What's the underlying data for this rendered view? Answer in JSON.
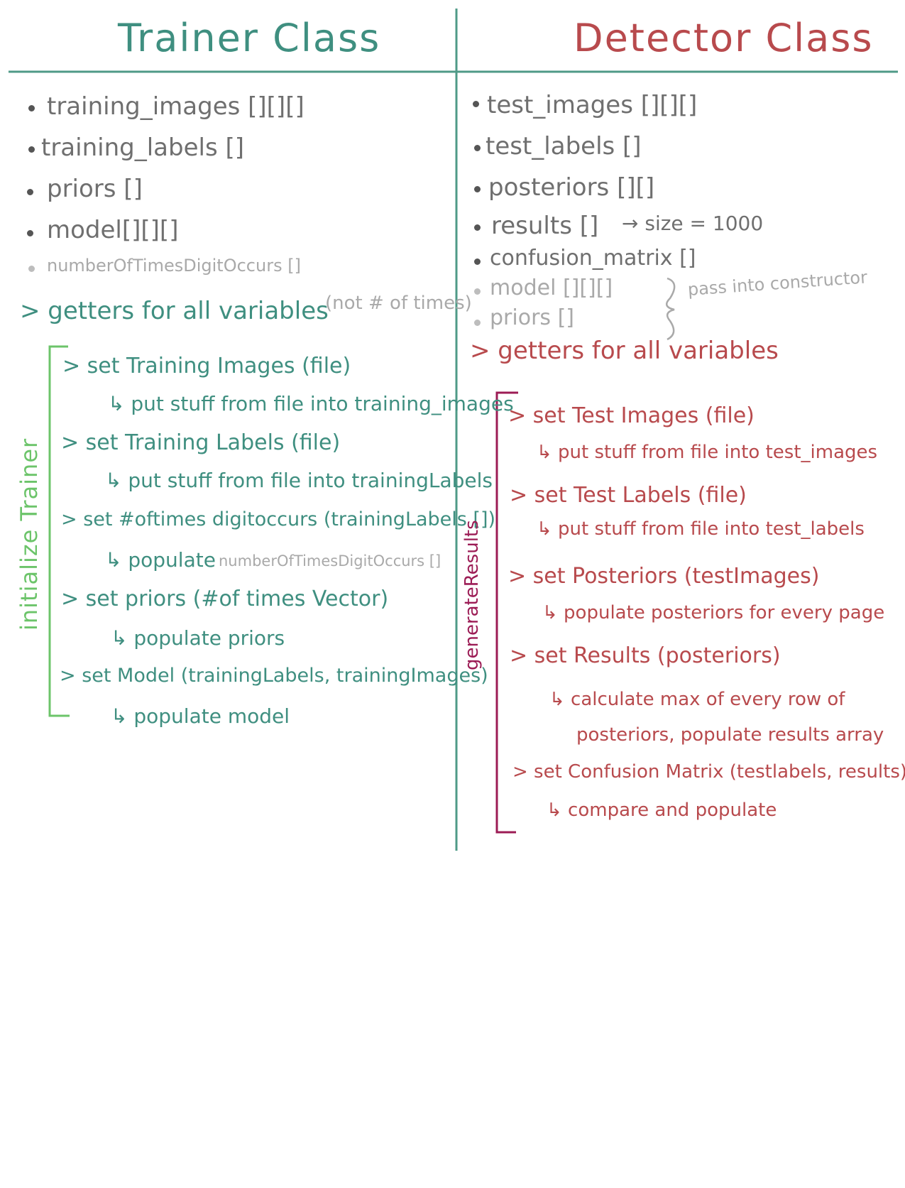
{
  "trainer": {
    "title": "Trainer Class",
    "variables": [
      "training_images [][][]",
      "training_labels []",
      "priors []",
      "model[][][]",
      "numberOfTimesDigitOccurs []"
    ],
    "getters": "> getters for all variables",
    "getters_note": "(not # of times)",
    "bracket_label": "initialize Trainer",
    "methods": [
      {
        "name": "> set Training Images (file)",
        "desc": "↳ put stuff from file into training_images"
      },
      {
        "name": "> set Training Labels (file)",
        "desc": "↳ put stuff from file into trainingLabels"
      },
      {
        "name": "> set #oftimes digitoccurs (trainingLabels [])",
        "desc": "↳ populate",
        "desc_extra": "numberOfTimesDigitOccurs []"
      },
      {
        "name": "> set priors (#of times Vector)",
        "desc": "↳ populate priors"
      },
      {
        "name": "> set Model (trainingLabels, trainingImages)",
        "desc": "↳ populate model"
      }
    ]
  },
  "detector": {
    "title": "Detector Class",
    "variables": [
      "test_images [][][]",
      "test_labels []",
      "posteriors [][]",
      "results []",
      "confusion_matrix []",
      "model [][][]",
      "priors []"
    ],
    "results_note": "→ size = 1000",
    "constructor_note": "pass into constructor",
    "getters": "> getters for all variables",
    "bracket_label": "generateResults",
    "methods": [
      {
        "name": "> set Test Images (file)",
        "desc": "↳ put stuff from file into test_images"
      },
      {
        "name": "> set Test Labels (file)",
        "desc": "↳ put stuff from file into test_labels"
      },
      {
        "name": "> set Posteriors (testImages)",
        "desc": "↳ populate posteriors for every page"
      },
      {
        "name": "> set Results (posteriors)",
        "desc": "↳ calculate max of every row of",
        "desc2": "posteriors, populate results array"
      },
      {
        "name": "> set Confusion Matrix (testlabels, results)",
        "desc": "↳ compare and populate"
      }
    ]
  },
  "colors": {
    "teal": "#3f8f80",
    "red": "#b84a4d",
    "green": "#6cc46a",
    "magenta": "#9c1c55",
    "gray": "#6f6f6f",
    "light_gray": "#a9a9a9"
  }
}
